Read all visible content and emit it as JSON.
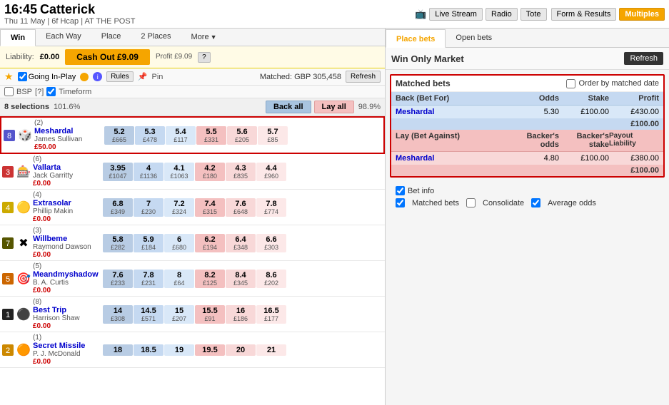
{
  "header": {
    "time": "16:45",
    "racecourse": "Catterick",
    "race_details": "Thu 11 May  |  6f Hcap  |  AT THE POST",
    "tv_icon": "📺",
    "live_stream": "Live Stream",
    "radio": "Radio",
    "tote": "Tote",
    "form_results": "Form & Results",
    "multiples": "Multiples"
  },
  "market_tabs": [
    {
      "label": "Win",
      "active": true
    },
    {
      "label": "Each Way",
      "active": false
    },
    {
      "label": "Place",
      "active": false
    },
    {
      "label": "2 Places",
      "active": false
    },
    {
      "label": "More",
      "active": false,
      "dropdown": true
    }
  ],
  "cashout": {
    "liability_label": "Liability:",
    "liability_val": "£0.00",
    "btn_label": "Cash Out £9.09",
    "sub_label": "Profit £9.09",
    "question_mark": "?"
  },
  "controls": {
    "going_in_play": "Going In-Play",
    "rules": "Rules",
    "pin": "Pin",
    "matched_label": "Matched: GBP 305,458",
    "refresh": "Refresh",
    "bsp": "BSP",
    "question": "[?]",
    "timeform": "Timeform"
  },
  "selections_header": {
    "count_label": "8 selections",
    "overround": "101.6%",
    "back_all": "Back all",
    "lay_all": "Lay all",
    "right_overround": "98.9%"
  },
  "selections": [
    {
      "num": "(2)",
      "rank": "8",
      "name": "Meshardal",
      "jockey": "James Sullivan",
      "price": "£50.00",
      "icon": "🎲",
      "back": [
        {
          "odds": "5.2",
          "avail": "£665"
        },
        {
          "odds": "5.3",
          "avail": "£478"
        },
        {
          "odds": "5.4",
          "avail": "£117"
        }
      ],
      "lay": [
        {
          "odds": "5.5",
          "avail": "£331"
        },
        {
          "odds": "5.6",
          "avail": "£205"
        },
        {
          "odds": "5.7",
          "avail": "£85"
        }
      ]
    },
    {
      "num": "(6)",
      "rank": "3",
      "name": "Vallarta",
      "jockey": "Jack Garritty",
      "price": "£0.00",
      "icon": "🎰",
      "back": [
        {
          "odds": "3.95",
          "avail": "£1047"
        },
        {
          "odds": "4",
          "avail": "£1136"
        },
        {
          "odds": "4.1",
          "avail": "£1063"
        }
      ],
      "lay": [
        {
          "odds": "4.2",
          "avail": "£180"
        },
        {
          "odds": "4.3",
          "avail": "£835"
        },
        {
          "odds": "4.4",
          "avail": "£960"
        }
      ]
    },
    {
      "num": "(4)",
      "rank": "4",
      "name": "Extrasolar",
      "jockey": "Phillip Makin",
      "price": "£0.00",
      "icon": "🟡",
      "back": [
        {
          "odds": "6.8",
          "avail": "£349"
        },
        {
          "odds": "7",
          "avail": "£230"
        },
        {
          "odds": "7.2",
          "avail": "£324"
        }
      ],
      "lay": [
        {
          "odds": "7.4",
          "avail": "£315"
        },
        {
          "odds": "7.6",
          "avail": "£648"
        },
        {
          "odds": "7.8",
          "avail": "£774"
        }
      ]
    },
    {
      "num": "(3)",
      "rank": "7",
      "name": "Willbeme",
      "jockey": "Raymond Dawson",
      "price": "£0.00",
      "icon": "✖",
      "back": [
        {
          "odds": "5.8",
          "avail": "£282"
        },
        {
          "odds": "5.9",
          "avail": "£184"
        },
        {
          "odds": "6",
          "avail": "£680"
        }
      ],
      "lay": [
        {
          "odds": "6.2",
          "avail": "£194"
        },
        {
          "odds": "6.4",
          "avail": "£348"
        },
        {
          "odds": "6.6",
          "avail": "£303"
        }
      ]
    },
    {
      "num": "(5)",
      "rank": "5",
      "name": "Meandmyshadow",
      "jockey": "B. A. Curtis",
      "price": "£0.00",
      "icon": "🎯",
      "back": [
        {
          "odds": "7.6",
          "avail": "£233"
        },
        {
          "odds": "7.8",
          "avail": "£231"
        },
        {
          "odds": "8",
          "avail": "£64"
        }
      ],
      "lay": [
        {
          "odds": "8.2",
          "avail": "£125"
        },
        {
          "odds": "8.4",
          "avail": "£345"
        },
        {
          "odds": "8.6",
          "avail": "£202"
        }
      ]
    },
    {
      "num": "(8)",
      "rank": "1",
      "name": "Best Trip",
      "jockey": "Harrison Shaw",
      "price": "£0.00",
      "icon": "⚫",
      "back": [
        {
          "odds": "14",
          "avail": "£308"
        },
        {
          "odds": "14.5",
          "avail": "£571"
        },
        {
          "odds": "15",
          "avail": "£207"
        }
      ],
      "lay": [
        {
          "odds": "15.5",
          "avail": "£91"
        },
        {
          "odds": "16",
          "avail": "£186"
        },
        {
          "odds": "16.5",
          "avail": "£177"
        }
      ]
    },
    {
      "num": "(1)",
      "rank": "2",
      "name": "Secret Missile",
      "jockey": "P. J. McDonald",
      "price": "£0.00",
      "icon": "🟠",
      "back": [
        {
          "odds": "18",
          "avail": ""
        },
        {
          "odds": "18.5",
          "avail": ""
        },
        {
          "odds": "19",
          "avail": ""
        }
      ],
      "lay": [
        {
          "odds": "19.5",
          "avail": ""
        },
        {
          "odds": "20",
          "avail": ""
        },
        {
          "odds": "21",
          "avail": ""
        }
      ]
    }
  ],
  "right_panel": {
    "tabs": [
      {
        "label": "Place bets",
        "active": true
      },
      {
        "label": "Open bets",
        "active": false
      }
    ],
    "win_only_title": "Win Only Market",
    "refresh_label": "Refresh",
    "matched_bets": {
      "title": "Matched bets",
      "order_by_label": "Order by matched date",
      "back_section": {
        "header": {
          "name": "Back (Bet For)",
          "col_odds": "Odds",
          "col_stake": "Stake",
          "col_profit": "Profit"
        },
        "rows": [
          {
            "name": "Meshardal",
            "odds": "5.30",
            "stake": "£100.00",
            "profit": "£430.00"
          }
        ],
        "total": "£100.00"
      },
      "lay_section": {
        "header": {
          "name": "Lay (Bet Against)",
          "col_odds": "Backer's odds",
          "col_stake": "Backer's stake",
          "col_profit_payout": "Payout",
          "col_profit_liability": "Liability"
        },
        "rows": [
          {
            "name": "Meshardal",
            "odds": "4.80",
            "stake": "£100.00",
            "profit": "£380.00"
          }
        ],
        "total": "£100.00"
      }
    },
    "bet_options": {
      "bet_info_label": "Bet info",
      "matched_bets_label": "Matched bets",
      "consolidate_label": "Consolidate",
      "average_odds_label": "Average odds"
    }
  }
}
